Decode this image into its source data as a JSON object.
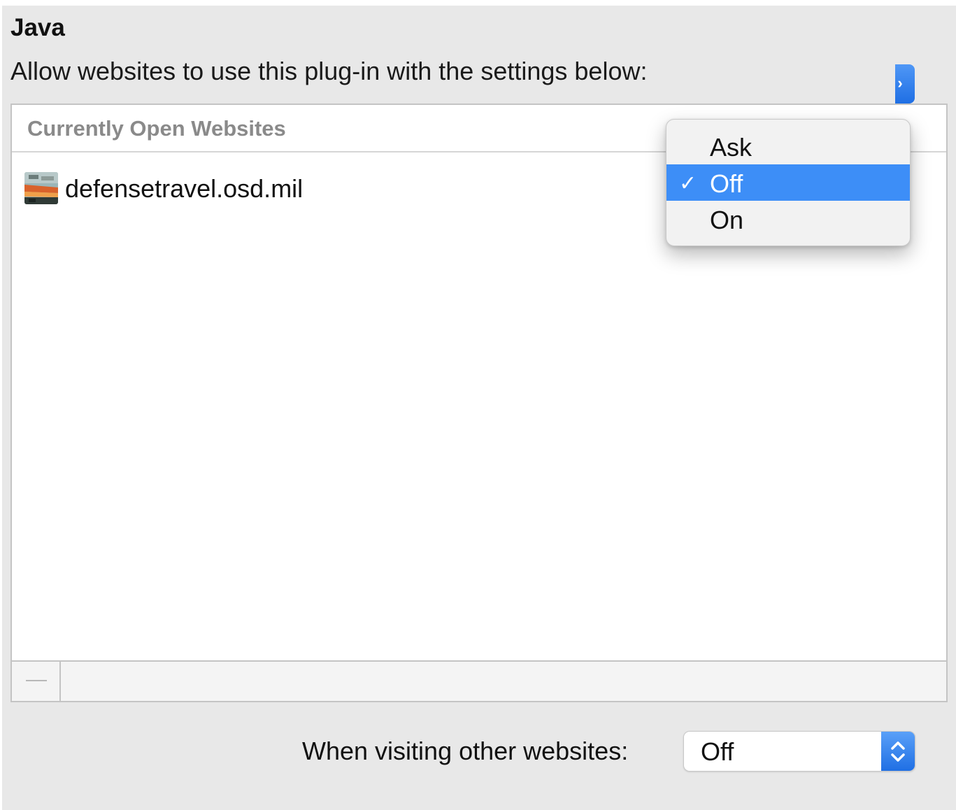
{
  "plugin": {
    "title": "Java",
    "subtitle": "Allow websites to use this plug-in with the settings below:"
  },
  "table": {
    "header": "Currently Open Websites",
    "rows": [
      {
        "site": "defensetravel.osd.mil",
        "setting": "Off"
      }
    ]
  },
  "dropdown": {
    "options": [
      "Ask",
      "Off",
      "On"
    ],
    "selected": "Off",
    "check_glyph": "✓"
  },
  "default_setting": {
    "label": "When visiting other websites:",
    "value": "Off"
  },
  "colors": {
    "accent": "#3d8ef7",
    "panel_bg": "#e8e8e8"
  },
  "icons": {
    "remove": "minus-icon",
    "stepper": "up-down-chevron-icon",
    "favicon": "site-favicon"
  }
}
